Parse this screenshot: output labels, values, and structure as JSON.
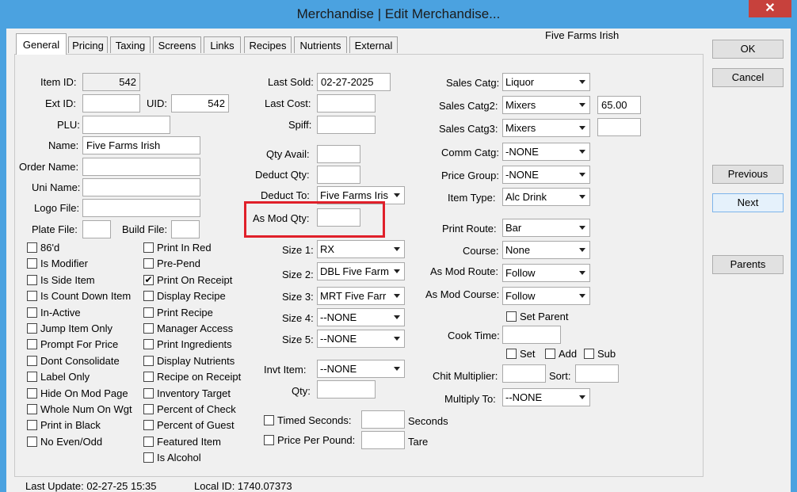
{
  "window": {
    "title": "Merchandise | Edit Merchandise...",
    "close_glyph": "✕",
    "item_caption": "Five Farms Irish"
  },
  "tabs": [
    "General",
    "Pricing",
    "Taxing",
    "Screens",
    "Links",
    "Recipes",
    "Nutrients",
    "External"
  ],
  "buttons": {
    "ok": "OK",
    "cancel": "Cancel",
    "previous": "Previous",
    "next": "Next",
    "parents": "Parents"
  },
  "left": {
    "item_id_label": "Item ID:",
    "item_id": "542",
    "ext_id_label": "Ext ID:",
    "ext_id": "",
    "uid_label": "UID:",
    "uid": "542",
    "plu_label": "PLU:",
    "plu": "",
    "name_label": "Name:",
    "name": "Five Farms Irish",
    "order_name_label": "Order Name:",
    "order_name": "",
    "uni_name_label": "Uni Name:",
    "uni_name": "",
    "logo_file_label": "Logo File:",
    "logo_file": "",
    "plate_file_label": "Plate File:",
    "plate_file": "",
    "build_file_label": "Build File:",
    "build_file": ""
  },
  "checks_col1": [
    {
      "label": "86'd",
      "checked": false
    },
    {
      "label": "Is Modifier",
      "checked": false
    },
    {
      "label": "Is Side Item",
      "checked": false
    },
    {
      "label": "Is Count Down Item",
      "checked": false
    },
    {
      "label": "In-Active",
      "checked": false
    },
    {
      "label": "Jump Item Only",
      "checked": false
    },
    {
      "label": "Prompt For Price",
      "checked": false
    },
    {
      "label": "Dont Consolidate",
      "checked": false
    },
    {
      "label": "Label Only",
      "checked": false
    },
    {
      "label": "Hide On Mod Page",
      "checked": false
    },
    {
      "label": "Whole Num On Wgt",
      "checked": false
    },
    {
      "label": "Print in Black",
      "checked": false
    },
    {
      "label": "No Even/Odd",
      "checked": false
    }
  ],
  "checks_col2": [
    {
      "label": "Print In Red",
      "checked": false
    },
    {
      "label": "Pre-Pend",
      "checked": false
    },
    {
      "label": "Print On Receipt",
      "checked": true
    },
    {
      "label": "Display Recipe",
      "checked": false
    },
    {
      "label": "Print Recipe",
      "checked": false
    },
    {
      "label": "Manager Access",
      "checked": false
    },
    {
      "label": "Print Ingredients",
      "checked": false
    },
    {
      "label": "Display Nutrients",
      "checked": false
    },
    {
      "label": "Recipe on Receipt",
      "checked": false
    },
    {
      "label": "Inventory Target",
      "checked": false
    },
    {
      "label": "Percent of Check",
      "checked": false
    },
    {
      "label": "Percent of Guest",
      "checked": false
    },
    {
      "label": "Featured Item",
      "checked": false
    },
    {
      "label": "Is Alcohol",
      "checked": false
    }
  ],
  "mid": {
    "last_sold_label": "Last Sold:",
    "last_sold": "02-27-2025",
    "last_cost_label": "Last Cost:",
    "last_cost": "",
    "spiff_label": "Spiff:",
    "spiff": "",
    "qty_avail_label": "Qty Avail:",
    "qty_avail": "",
    "deduct_qty_label": "Deduct Qty:",
    "deduct_qty": "",
    "deduct_to_label": "Deduct To:",
    "deduct_to": "Five Farms Iris",
    "as_mod_qty_label": "As Mod Qty:",
    "as_mod_qty": "",
    "size1_label": "Size 1:",
    "size1": "RX",
    "size2_label": "Size 2:",
    "size2": "DBL Five Farm",
    "size3_label": "Size 3:",
    "size3": "MRT Five Farr",
    "size4_label": "Size 4:",
    "size4": "--NONE",
    "size5_label": "Size 5:",
    "size5": "--NONE",
    "invt_item_label": "Invt Item:",
    "invt_item": "--NONE",
    "qty_label": "Qty:",
    "qty": "",
    "timed_seconds_label": "Timed Seconds:",
    "timed_seconds": "",
    "seconds_unit": "Seconds",
    "price_per_pound_label": "Price Per Pound:",
    "price_per_pound": "",
    "tare_label": "Tare"
  },
  "right": {
    "sales_catg_label": "Sales Catg:",
    "sales_catg": "Liquor",
    "sales_catg2_label": "Sales Catg2:",
    "sales_catg2": "Mixers",
    "sales_catg2_value": "65.00",
    "sales_catg3_label": "Sales Catg3:",
    "sales_catg3": "Mixers",
    "sales_catg3_value": "",
    "comm_catg_label": "Comm Catg:",
    "comm_catg": "-NONE",
    "price_group_label": "Price Group:",
    "price_group": "-NONE",
    "item_type_label": "Item Type:",
    "item_type": "Alc Drink",
    "print_route_label": "Print Route:",
    "print_route": "Bar",
    "course_label": "Course:",
    "course": "None",
    "as_mod_route_label": "As Mod Route:",
    "as_mod_route": "Follow",
    "as_mod_course_label": "As Mod Course:",
    "as_mod_course": "Follow",
    "set_parent_label": "Set Parent",
    "cook_time_label": "Cook Time:",
    "cook_time": "",
    "set_label": "Set",
    "add_label": "Add",
    "sub_label": "Sub",
    "chit_multiplier_label": "Chit Multiplier:",
    "chit_multiplier": "",
    "sort_label": "Sort:",
    "sort": "",
    "multiply_to_label": "Multiply To:",
    "multiply_to": "--NONE"
  },
  "footer": {
    "last_update": "Last Update:  02-27-25 15:35",
    "local_id": "Local ID:  1740.07373"
  },
  "colors": {
    "title_bar": "#4ba2e0",
    "close_button": "#c7413c",
    "highlight_box": "#e0202a",
    "dialog_bg": "#f0f0f0"
  }
}
